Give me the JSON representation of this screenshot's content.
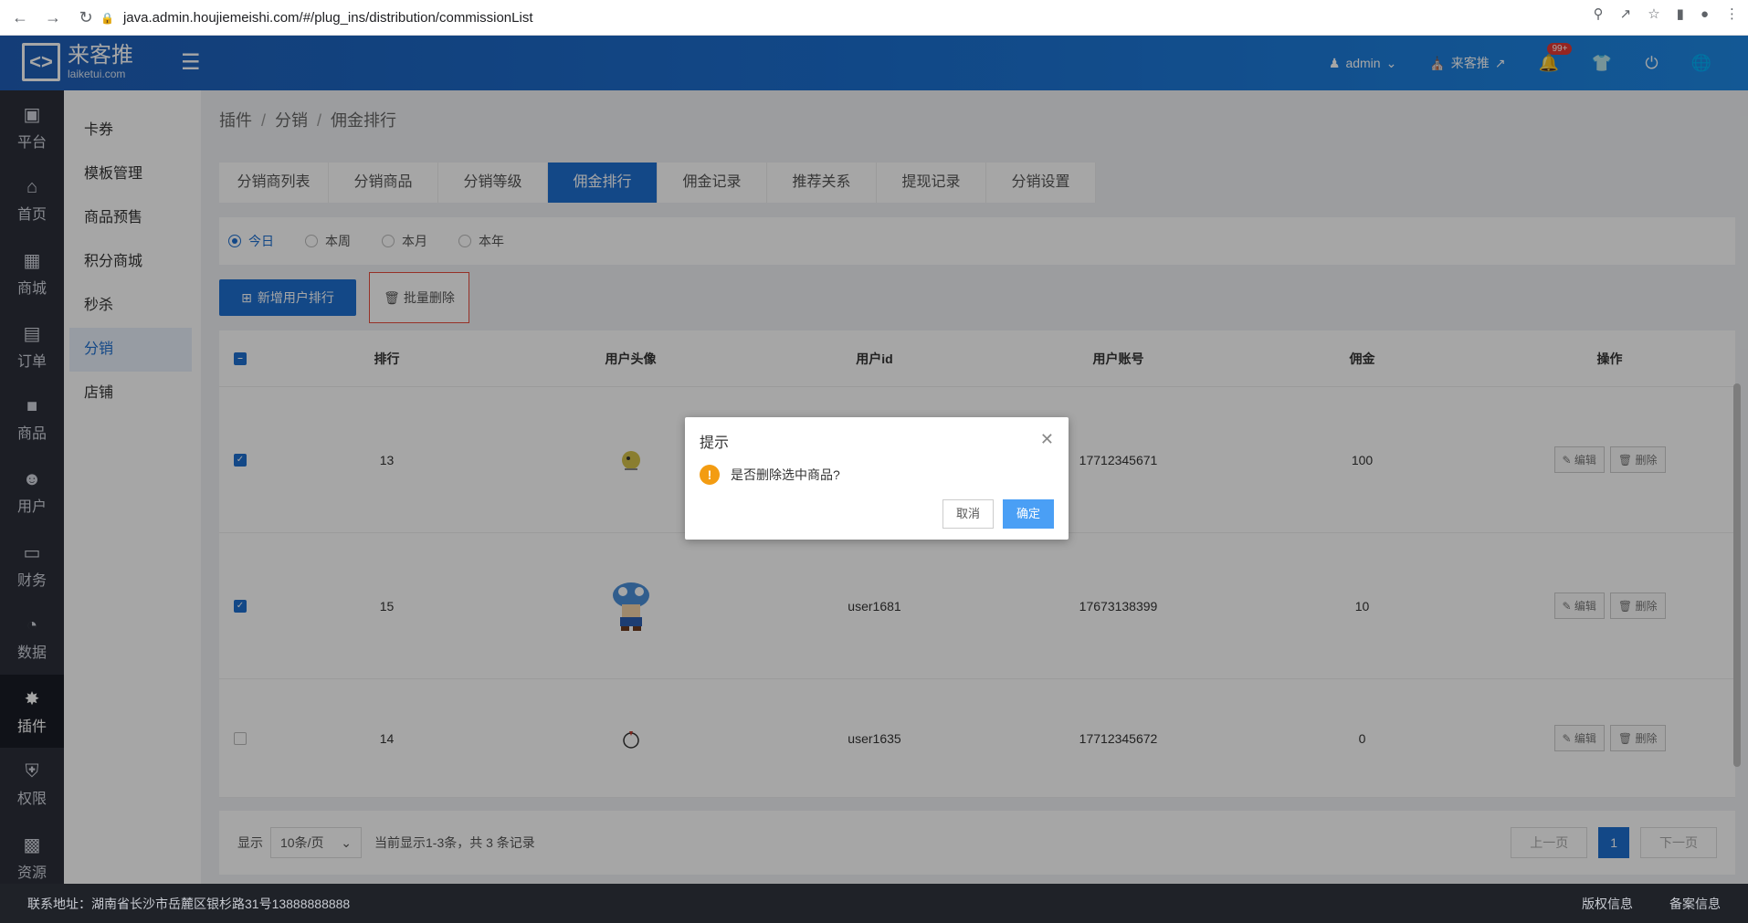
{
  "browser": {
    "url": "java.admin.houjiemeishi.com/#/plug_ins/distribution/commissionList"
  },
  "header": {
    "logo_cn": "来客推",
    "logo_en": "laiketui.com",
    "user": "admin",
    "store": "来客推",
    "notify_badge": "99+"
  },
  "iconbar": [
    {
      "label": "平台",
      "icon": "platform-icon"
    },
    {
      "label": "首页",
      "icon": "home-icon"
    },
    {
      "label": "商城",
      "icon": "mall-icon"
    },
    {
      "label": "订单",
      "icon": "order-icon"
    },
    {
      "label": "商品",
      "icon": "goods-icon"
    },
    {
      "label": "用户",
      "icon": "user-icon"
    },
    {
      "label": "财务",
      "icon": "wallet-icon"
    },
    {
      "label": "数据",
      "icon": "chart-icon"
    },
    {
      "label": "插件",
      "icon": "plugin-icon"
    },
    {
      "label": "权限",
      "icon": "shield-icon"
    },
    {
      "label": "资源",
      "icon": "image-icon"
    }
  ],
  "submenu": [
    "卡券",
    "模板管理",
    "商品预售",
    "积分商城",
    "秒杀",
    "分销",
    "店铺"
  ],
  "breadcrumb": [
    "插件",
    "分销",
    "佣金排行"
  ],
  "tabs": [
    "分销商列表",
    "分销商品",
    "分销等级",
    "佣金排行",
    "佣金记录",
    "推荐关系",
    "提现记录",
    "分销设置"
  ],
  "filters": [
    "今日",
    "本周",
    "本月",
    "本年"
  ],
  "actions": {
    "add": "新增用户排行",
    "batch_delete": "批量删除"
  },
  "table": {
    "headers": [
      "排行",
      "用户头像",
      "用户id",
      "用户账号",
      "佣金",
      "操作"
    ],
    "rows": [
      {
        "rank": "13",
        "uid": "",
        "account": "17712345671",
        "commission": "100",
        "checked": true
      },
      {
        "rank": "15",
        "uid": "user1681",
        "account": "17673138399",
        "commission": "10",
        "checked": true
      },
      {
        "rank": "14",
        "uid": "user1635",
        "account": "17712345672",
        "commission": "0",
        "checked": false
      }
    ],
    "edit": "编辑",
    "delete": "删除"
  },
  "pager": {
    "show": "显示",
    "per_page": "10条/页",
    "summary": "当前显示1-3条，共 3 条记录",
    "prev": "上一页",
    "current": "1",
    "next": "下一页"
  },
  "footer": {
    "address": "联系地址：湖南省长沙市岳麓区银杉路31号13888888888",
    "copyright": "版权信息",
    "icp": "备案信息"
  },
  "dialog": {
    "title": "提示",
    "message": "是否删除选中商品?",
    "cancel": "取消",
    "ok": "确定"
  }
}
